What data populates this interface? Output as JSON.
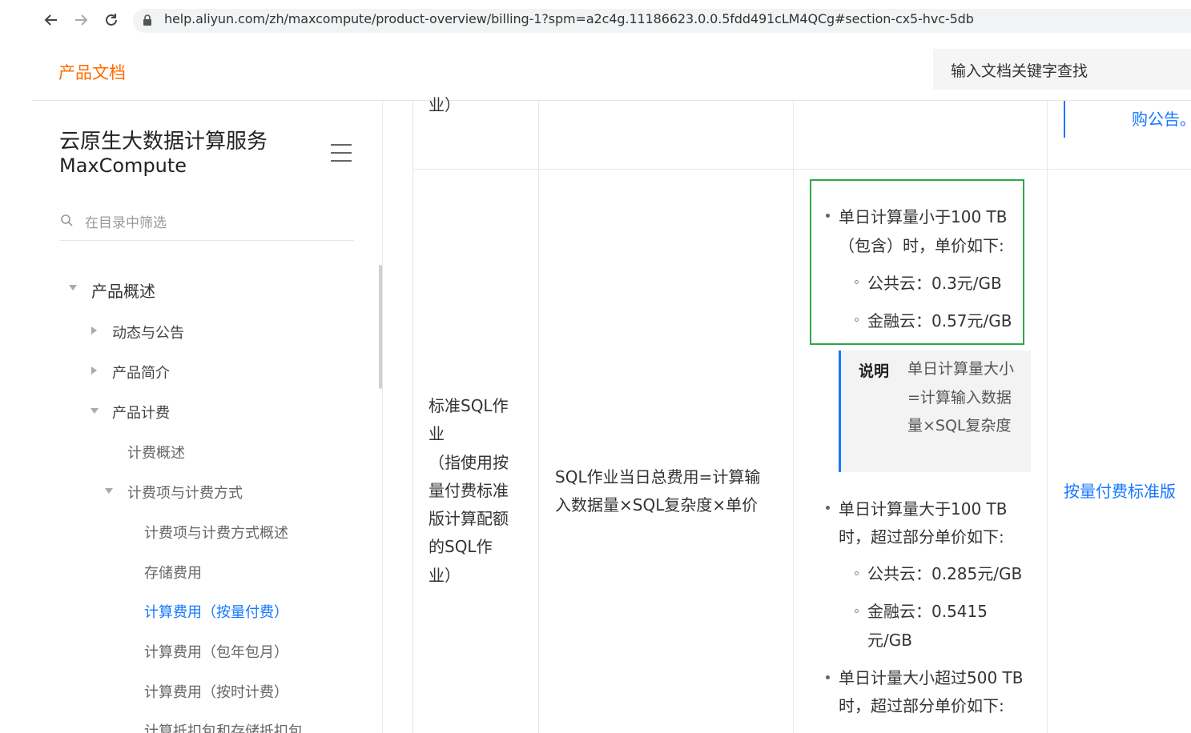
{
  "browser": {
    "back_icon": "arrow-left-icon",
    "forward_icon": "arrow-right-icon",
    "reload_icon": "reload-icon",
    "url": "help.aliyun.com/zh/maxcompute/product-overview/billing-1?spm=a2c4g.11186623.0.0.5fdd491cLM4QCg#section-cx5-hvc-5db"
  },
  "header": {
    "title": "产品文档",
    "search_placeholder": "输入文档关键字查找"
  },
  "sidebar": {
    "product_name_cn": "云原生大数据计算服务",
    "product_name_en": "MaxCompute",
    "filter_placeholder": "在目录中筛选",
    "items": [
      {
        "label": "产品概述"
      },
      {
        "label": "动态与公告"
      },
      {
        "label": "产品简介"
      },
      {
        "label": "产品计费"
      },
      {
        "label": "计费概述"
      },
      {
        "label": "计费项与计费方式"
      },
      {
        "label": "计费项与计费方式概述"
      },
      {
        "label": "存储费用"
      },
      {
        "label": "计算费用（按量付费）"
      },
      {
        "label": "计算费用（包年包月）"
      },
      {
        "label": "计算费用（按时计费）"
      },
      {
        "label": "计算抵扣包和存储抵扣包"
      }
    ]
  },
  "table": {
    "prev_row_tail": "业）",
    "prev_row_link": "购公告。",
    "job_type": [
      "标准SQL作",
      "业",
      "（指使用按",
      "量付费标准",
      "版计算配额",
      "的SQL作",
      "业）"
    ],
    "formula": [
      "SQL作业当日总费用=计算输",
      "入数据量×SQL复杂度×单价"
    ],
    "tier1_a": "单日计算量小于100 TB",
    "tier1_b": "（包含）时，单价如下:",
    "tier1_public": "公共云：0.3元/GB",
    "tier1_finance": "金融云：0.57元/GB",
    "note_label": "说明",
    "note_text": "单日计算量大小=计算输入数据量×SQL复杂度",
    "tier2_a": "单日计算量大于100 TB",
    "tier2_b": "时，超过部分单价如下:",
    "tier2_public": "公共云：0.285元/GB",
    "tier2_finance_a": "金融云：0.5415",
    "tier2_finance_b": "元/GB",
    "tier3_a": "单日计量大小超过500 TB",
    "tier3_b": "时，超过部分单价如下:",
    "edition_link": "按量付费标准版"
  }
}
